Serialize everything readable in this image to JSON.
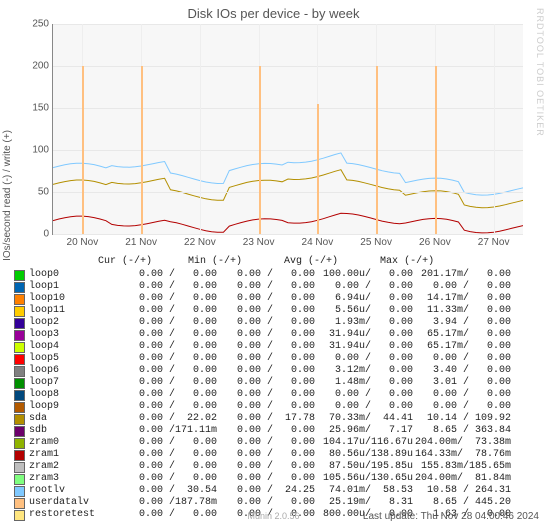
{
  "title": "Disk IOs per device - by week",
  "ylabel": "IOs/second read (-) / write (+)",
  "watermark": "RRDTOOL  TOBI OETIKER",
  "footer_tool": "Munin 2.0.56",
  "last_update": "Last update: Thu Nov 28 04:00:46 2024",
  "yticks": [
    0,
    50,
    100,
    150,
    200,
    250
  ],
  "ymax": 250,
  "xticks": [
    "20 Nov",
    "21 Nov",
    "22 Nov",
    "23 Nov",
    "24 Nov",
    "25 Nov",
    "26 Nov",
    "27 Nov"
  ],
  "legend_header": "              Cur (-/+)      Min (-/+)       Avg (-/+)       Max (-/+)",
  "devices": [
    {
      "name": "loop0",
      "color": "#00cc00",
      "cur": "0.00 /   0.00",
      "min": "0.00 /   0.00",
      "avg": "100.00u/   0.00",
      "max": "201.17m/   0.00"
    },
    {
      "name": "loop1",
      "color": "#0066b3",
      "cur": "0.00 /   0.00",
      "min": "0.00 /   0.00",
      "avg": "0.00 /   0.00",
      "max": "0.00 /   0.00"
    },
    {
      "name": "loop10",
      "color": "#ff8000",
      "cur": "0.00 /   0.00",
      "min": "0.00 /   0.00",
      "avg": "6.94u/   0.00",
      "max": "14.17m/   0.00"
    },
    {
      "name": "loop11",
      "color": "#ffcc00",
      "cur": "0.00 /   0.00",
      "min": "0.00 /   0.00",
      "avg": "5.56u/   0.00",
      "max": "11.33m/   0.00"
    },
    {
      "name": "loop2",
      "color": "#330099",
      "cur": "0.00 /   0.00",
      "min": "0.00 /   0.00",
      "avg": "1.93m/   0.00",
      "max": "3.94 /   0.00"
    },
    {
      "name": "loop3",
      "color": "#990099",
      "cur": "0.00 /   0.00",
      "min": "0.00 /   0.00",
      "avg": "31.94u/   0.00",
      "max": "65.17m/   0.00"
    },
    {
      "name": "loop4",
      "color": "#ccff00",
      "cur": "0.00 /   0.00",
      "min": "0.00 /   0.00",
      "avg": "31.94u/   0.00",
      "max": "65.17m/   0.00"
    },
    {
      "name": "loop5",
      "color": "#ff0000",
      "cur": "0.00 /   0.00",
      "min": "0.00 /   0.00",
      "avg": "0.00 /   0.00",
      "max": "0.00 /   0.00"
    },
    {
      "name": "loop6",
      "color": "#808080",
      "cur": "0.00 /   0.00",
      "min": "0.00 /   0.00",
      "avg": "3.12m/   0.00",
      "max": "3.40 /   0.00"
    },
    {
      "name": "loop7",
      "color": "#008f00",
      "cur": "0.00 /   0.00",
      "min": "0.00 /   0.00",
      "avg": "1.48m/   0.00",
      "max": "3.01 /   0.00"
    },
    {
      "name": "loop8",
      "color": "#00487d",
      "cur": "0.00 /   0.00",
      "min": "0.00 /   0.00",
      "avg": "0.00 /   0.00",
      "max": "0.00 /   0.00"
    },
    {
      "name": "loop9",
      "color": "#b35a00",
      "cur": "0.00 /   0.00",
      "min": "0.00 /   0.00",
      "avg": "0.00 /   0.00",
      "max": "0.00 /   0.00"
    },
    {
      "name": "sda",
      "color": "#b38f00",
      "cur": "0.00 /  22.02",
      "min": "0.00 /  17.78",
      "avg": "70.33m/  44.41",
      "max": "10.14 / 109.92"
    },
    {
      "name": "sdb",
      "color": "#6b006b",
      "cur": "0.00 /171.11m",
      "min": "0.00 /   0.00",
      "avg": "25.96m/   7.17",
      "max": "8.65 / 363.84"
    },
    {
      "name": "zram0",
      "color": "#8fb300",
      "cur": "0.00 /   0.00",
      "min": "0.00 /   0.00",
      "avg": "104.17u/116.67u",
      "max": "204.00m/  73.38m"
    },
    {
      "name": "zram1",
      "color": "#b30000",
      "cur": "0.00 /   0.00",
      "min": "0.00 /   0.00",
      "avg": "80.56u/138.89u",
      "max": "164.33m/  78.76m"
    },
    {
      "name": "zram2",
      "color": "#bebebe",
      "cur": "0.00 /   0.00",
      "min": "0.00 /   0.00",
      "avg": "87.50u/195.85u",
      "max": "155.83m/185.65m"
    },
    {
      "name": "zram3",
      "color": "#80ff80",
      "cur": "0.00 /   0.00",
      "min": "0.00 /   0.00",
      "avg": "105.56u/130.65u",
      "max": "204.00m/  81.84m"
    },
    {
      "name": "rootlv",
      "color": "#80c9ff",
      "cur": "0.00 /  30.54",
      "min": "0.00 /  24.25",
      "avg": "74.01m/  58.53",
      "max": "10.58 / 264.31"
    },
    {
      "name": "userdatalv",
      "color": "#ffc080",
      "cur": "0.00 /187.78m",
      "min": "0.00 /   0.00",
      "avg": "25.19m/   8.31",
      "max": "8.65 / 445.20"
    },
    {
      "name": "restoretest",
      "color": "#ffe680",
      "cur": "0.00 /   0.00",
      "min": "0.00 /   0.00",
      "avg": "800.00u/   0.00",
      "max": "1.63 /   0.00"
    }
  ],
  "chart_data": {
    "type": "line",
    "title": "Disk IOs per device - by week",
    "xlabel": "",
    "ylabel": "IOs/second read (-) / write (+)",
    "ylim": [
      0,
      250
    ],
    "x": [
      "20 Nov",
      "21 Nov",
      "22 Nov",
      "23 Nov",
      "24 Nov",
      "25 Nov",
      "26 Nov",
      "27 Nov"
    ],
    "spikes": [
      {
        "x": "20 Nov",
        "value": 200
      },
      {
        "x": "21 Nov",
        "value": 200
      },
      {
        "x": "23 Nov",
        "value": 200
      },
      {
        "x": "24 Nov",
        "value": 155
      },
      {
        "x": "25 Nov",
        "value": 200
      },
      {
        "x": "26 Nov",
        "value": 200
      }
    ],
    "series": [
      {
        "name": "rootlv",
        "color": "#80c9ff",
        "values": [
          75,
          85,
          70,
          80,
          90,
          75,
          60,
          55
        ]
      },
      {
        "name": "sda",
        "color": "#b38f00",
        "values": [
          55,
          65,
          50,
          60,
          70,
          55,
          45,
          40
        ]
      },
      {
        "name": "zram1",
        "color": "#b30000",
        "values": [
          12,
          15,
          12,
          14,
          18,
          15,
          12,
          10
        ]
      }
    ]
  }
}
